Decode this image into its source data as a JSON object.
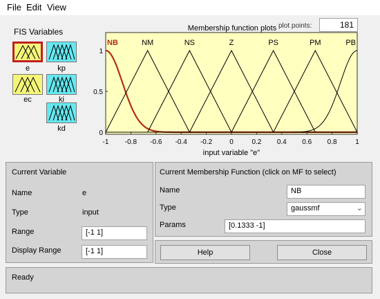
{
  "menu": [
    "File",
    "Edit",
    "View"
  ],
  "fis_variables": {
    "title": "FIS Variables",
    "inputs": [
      {
        "name": "e",
        "fill": "#f5f57a",
        "selected": true
      },
      {
        "name": "ec",
        "fill": "#f5f57a",
        "selected": false
      }
    ],
    "outputs": [
      {
        "name": "kp",
        "fill": "#66e8f0"
      },
      {
        "name": "ki",
        "fill": "#66e8f0"
      },
      {
        "name": "kd",
        "fill": "#66e8f0"
      }
    ]
  },
  "plot_points": {
    "label": "plot points:",
    "value": "181"
  },
  "chart_data": {
    "type": "line",
    "title": "Membership function plots",
    "xlabel": "input variable \"e\"",
    "ylabel": "",
    "xlim": [
      -1,
      1
    ],
    "ylim": [
      0,
      1
    ],
    "xticks": [
      "-1",
      "-0.8",
      "-0.6",
      "-0.4",
      "-0.2",
      "0",
      "0.2",
      "0.4",
      "0.6",
      "0.8",
      "1"
    ],
    "yticks": [
      "0",
      "0.5",
      "1"
    ],
    "background": "#ffffc0",
    "series": [
      {
        "name": "NB",
        "type": "gaussmf",
        "params": [
          0.1333,
          -1
        ],
        "peak": -1,
        "highlight": true
      },
      {
        "name": "NM",
        "type": "trimf",
        "params": [
          -1,
          -0.6667,
          -0.3333
        ],
        "peak": -0.6667
      },
      {
        "name": "NS",
        "type": "trimf",
        "params": [
          -0.6667,
          -0.3333,
          0
        ],
        "peak": -0.3333
      },
      {
        "name": "Z",
        "type": "trimf",
        "params": [
          -0.3333,
          0,
          0.3333
        ],
        "peak": 0
      },
      {
        "name": "PS",
        "type": "trimf",
        "params": [
          0,
          0.3333,
          0.6667
        ],
        "peak": 0.3333
      },
      {
        "name": "PM",
        "type": "trimf",
        "params": [
          0.3333,
          0.6667,
          1
        ],
        "peak": 0.6667
      },
      {
        "name": "PB",
        "type": "gaussmf",
        "params": [
          0.1333,
          1
        ],
        "peak": 1
      }
    ],
    "highlight_color": "#b03010"
  },
  "current_variable": {
    "title": "Current Variable",
    "name_label": "Name",
    "name_value": "e",
    "type_label": "Type",
    "type_value": "input",
    "range_label": "Range",
    "range_value": "[-1 1]",
    "display_range_label": "Display Range",
    "display_range_value": "[-1 1]"
  },
  "current_mf": {
    "title": "Current Membership Function (click on MF to select)",
    "name_label": "Name",
    "name_value": "NB",
    "type_label": "Type",
    "type_value": "gaussmf",
    "params_label": "Params",
    "params_value": "[0.1333 -1]"
  },
  "buttons": {
    "help": "Help",
    "close": "Close"
  },
  "status": "Ready"
}
